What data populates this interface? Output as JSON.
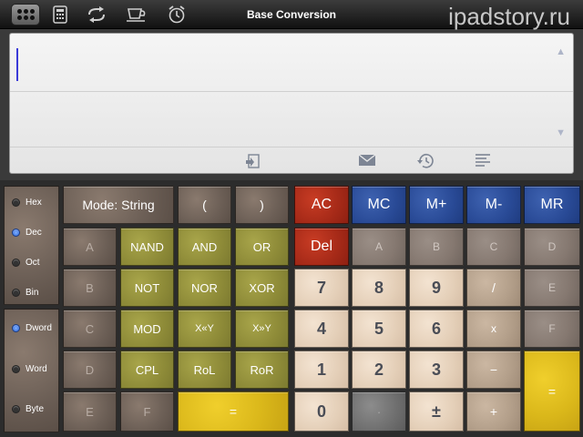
{
  "header": {
    "title": "Base Conversion",
    "watermark": "ipadstory.ru",
    "icons": [
      "apps-grid-icon",
      "calculator-icon",
      "convert-icon",
      "cup-icon",
      "alarm-clock-icon"
    ]
  },
  "display": {
    "value": "",
    "tools": [
      "paste-icon",
      "mail-icon",
      "history-icon",
      "list-icon"
    ]
  },
  "radios": {
    "base": [
      {
        "label": "Hex",
        "selected": false
      },
      {
        "label": "Dec",
        "selected": true
      },
      {
        "label": "Oct",
        "selected": false
      },
      {
        "label": "Bin",
        "selected": false
      }
    ],
    "size": [
      {
        "label": "Dword",
        "selected": true
      },
      {
        "label": "Word",
        "selected": false
      },
      {
        "label": "Byte",
        "selected": false
      }
    ]
  },
  "keys": {
    "mode": "Mode: String",
    "paren_open": "(",
    "paren_close": ")",
    "ac": "AC",
    "mc": "MC",
    "mplus": "M+",
    "mminus": "M-",
    "mr": "MR",
    "del": "Del",
    "row2": {
      "a1": "A",
      "nand": "NAND",
      "and": "AND",
      "or": "OR",
      "a2": "A",
      "b2": "B",
      "c2": "C",
      "d2": "D"
    },
    "row3": {
      "b1": "B",
      "not": "NOT",
      "nor": "NOR",
      "xor": "XOR",
      "n7": "7",
      "n8": "8",
      "n9": "9",
      "div": "/",
      "e2": "E"
    },
    "row4": {
      "c1": "C",
      "mod": "MOD",
      "shl": "X«Y",
      "shr": "X»Y",
      "n4": "4",
      "n5": "5",
      "n6": "6",
      "mul": "x",
      "f2": "F"
    },
    "row5": {
      "d1": "D",
      "cpl": "CPL",
      "rol": "RoL",
      "ror": "RoR",
      "n1": "1",
      "n2": "2",
      "n3": "3",
      "minus": "−"
    },
    "row6": {
      "e1": "E",
      "f1": "F",
      "eq1": "=",
      "n0": "0",
      "dot": "·",
      "pm": "±",
      "plus": "+"
    },
    "eq2": "="
  }
}
